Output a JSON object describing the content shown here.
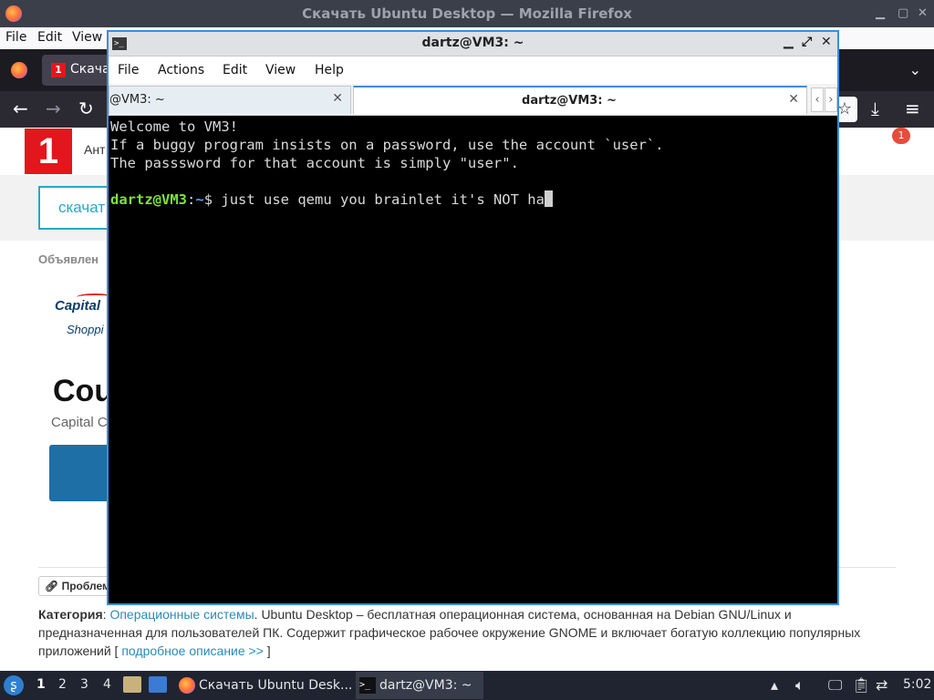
{
  "firefox": {
    "window_title": "Скачать Ubuntu Desktop — Mozilla Firefox",
    "menu": [
      "File",
      "Edit",
      "View"
    ],
    "tab_label": "Скача",
    "tab_favicon": "1",
    "site": {
      "logo_text": "1",
      "header_text": "Ант",
      "notification_count": "1",
      "download_button": "скачат",
      "ads_label": "Объявлен",
      "ad_brand": "Capital",
      "ad_brand_sub": "Shoppi",
      "ad_heading": "Cou",
      "ad_subheading": "Capital C",
      "problem_button": "Проблем",
      "category_label": "Категория",
      "category_link": "Операционные системы",
      "description": ". Ubuntu Desktop – бесплатная операционная система, основанная на Debian GNU/Linux и предназначенная для пользователей ПК. Содержит графическое рабочее окружение GNOME и включает богатую коллекцию популярных приложений [ ",
      "more_link": "подробное описание >>",
      "more_suffix": " ]"
    }
  },
  "terminal": {
    "window_title": "dartz@VM3: ~",
    "menu": [
      "File",
      "Actions",
      "Edit",
      "View",
      "Help"
    ],
    "tabs": [
      {
        "label": "@VM3: ~"
      },
      {
        "label": "dartz@VM3: ~"
      }
    ],
    "lines": [
      "Welcome to VM3!",
      "If a buggy program insists on a password, use the account `user`.",
      "The passsword for that account is simply \"user\".",
      ""
    ],
    "prompt_user": "dartz@VM3",
    "prompt_sep": ":",
    "prompt_path": "~",
    "prompt_symbol": "$ ",
    "command": "just use qemu you brainlet it's NOT ha"
  },
  "taskbar": {
    "workspaces": [
      "1",
      "2",
      "3",
      "4"
    ],
    "active_workspace": "1",
    "tasks": [
      {
        "label": "Скачать Ubuntu Desk...",
        "icon": "firefox-icon"
      },
      {
        "label": "dartz@VM3: ~",
        "icon": "terminal-icon"
      }
    ],
    "clock": "5:02"
  }
}
